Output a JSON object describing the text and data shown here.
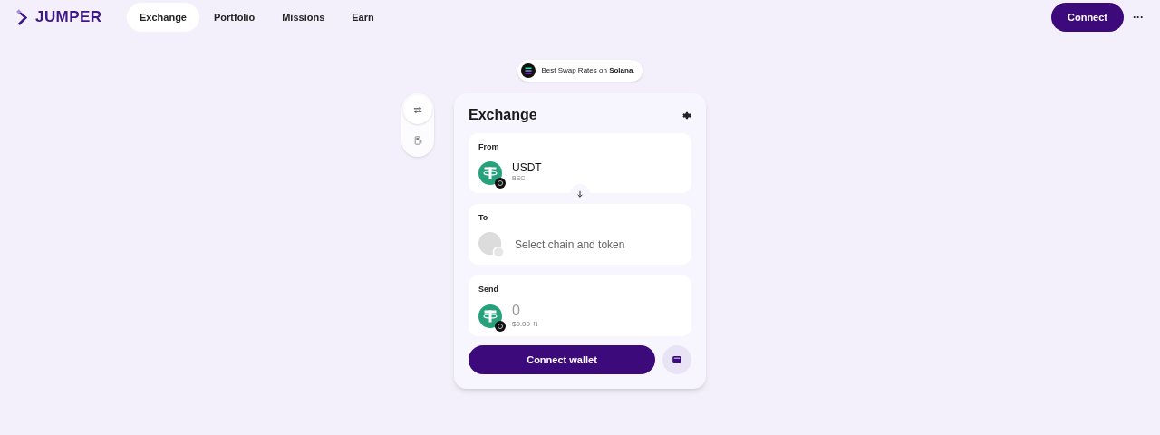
{
  "brand": {
    "name": "JUMPER"
  },
  "nav": [
    {
      "label": "Exchange",
      "selected": true
    },
    {
      "label": "Portfolio",
      "selected": false
    },
    {
      "label": "Missions",
      "selected": false
    },
    {
      "label": "Earn",
      "selected": false
    }
  ],
  "connect_button": "Connect",
  "more_button": "···",
  "banner": {
    "text": "Best Swap Rates on **Solana**."
  },
  "side_tabs": [
    {
      "kind": "swap",
      "selected": true
    },
    {
      "kind": "gas",
      "selected": false
    }
  ],
  "card": {
    "title": "Exchange",
    "from": {
      "label": "From",
      "token": "USDT",
      "chain": "BSC"
    },
    "to": {
      "label": "To",
      "placeholder": "Select chain and token"
    },
    "send": {
      "label": "Send",
      "placeholder": "0",
      "usd": "$0.00"
    },
    "connect_wallet": "Connect wallet"
  }
}
